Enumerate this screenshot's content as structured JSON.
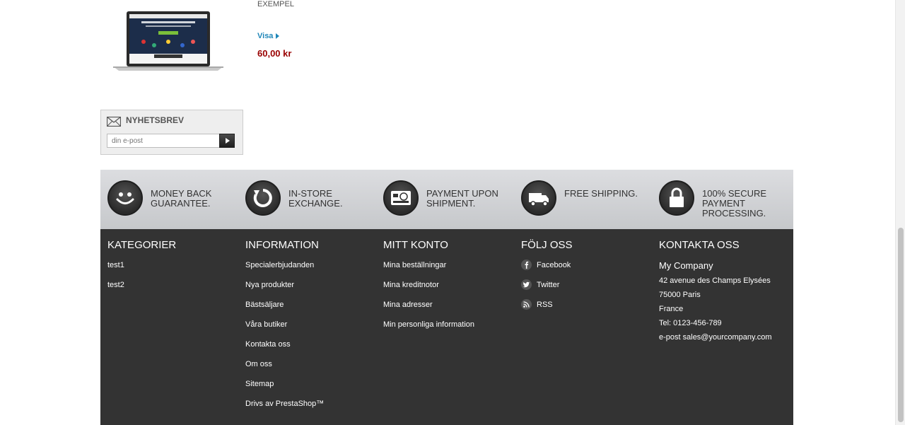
{
  "product": {
    "label": "EXEMPEL",
    "view_link": "Visa",
    "price": "60,00 kr"
  },
  "newsletter": {
    "title": "NYHETSBREV",
    "placeholder": "din e-post"
  },
  "reassurance": [
    {
      "icon": "smiley-icon",
      "text": "MONEY BACK GUARANTEE."
    },
    {
      "icon": "refresh-icon",
      "text": "IN-STORE EXCHANGE."
    },
    {
      "icon": "credit-card-icon",
      "text": "PAYMENT UPON SHIPMENT."
    },
    {
      "icon": "truck-icon",
      "text": "FREE SHIPPING."
    },
    {
      "icon": "lock-icon",
      "text": "100% SECURE PAYMENT PROCESSING."
    }
  ],
  "footer": {
    "categories": {
      "title": "KATEGORIER",
      "items": [
        "test1",
        "test2"
      ]
    },
    "information": {
      "title": "INFORMATION",
      "items": [
        "Specialerbjudanden",
        "Nya produkter",
        "Bästsäljare",
        "Våra butiker",
        "Kontakta oss",
        "Om oss",
        "Sitemap",
        "Drivs av PrestaShop™"
      ]
    },
    "account": {
      "title": "MITT KONTO",
      "items": [
        "Mina beställningar",
        "Mina kreditnotor",
        "Mina adresser",
        "Min personliga information"
      ]
    },
    "follow": {
      "title": "FÖLJ OSS",
      "items": [
        {
          "icon": "facebook-icon",
          "label": "Facebook"
        },
        {
          "icon": "twitter-icon",
          "label": "Twitter"
        },
        {
          "icon": "rss-icon",
          "label": "RSS"
        }
      ]
    },
    "contact": {
      "title": "KONTAKTA OSS",
      "company": "My Company",
      "address1": "42 avenue des Champs Elysées",
      "address2": "75000 Paris",
      "country": "France",
      "phone": "Tel: 0123-456-789",
      "email": "e-post sales@yourcompany.com"
    }
  },
  "colors": {
    "link": "#1e86b8",
    "price": "#990000",
    "footer_bg": "#333333"
  }
}
